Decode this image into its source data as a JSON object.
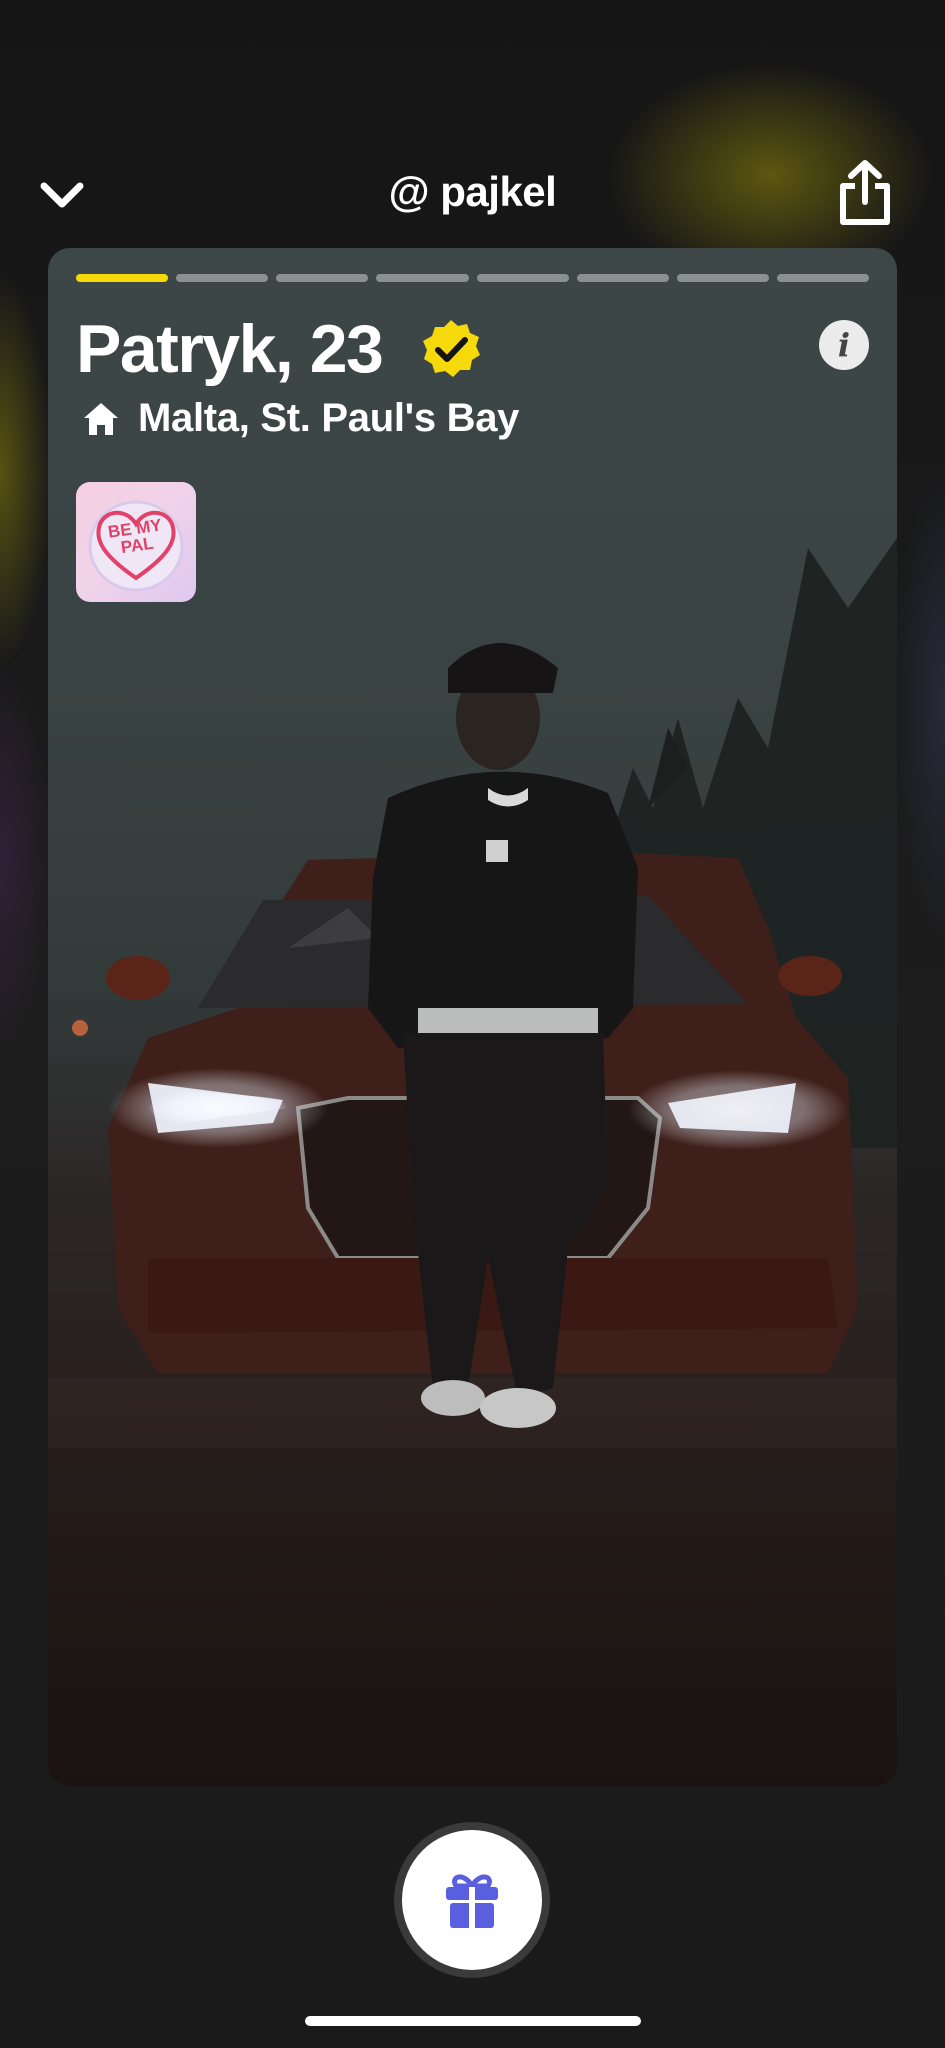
{
  "header": {
    "username": "@ pajkel",
    "back_icon": "chevron-down-icon",
    "share_icon": "share-icon"
  },
  "story": {
    "segments_total": 8,
    "segment_active": 1,
    "active_color": "#f5d90a"
  },
  "profile": {
    "name_age": "Patryk, 23",
    "verified_icon": "verified-badge-icon",
    "verified_color": "#f5d90a",
    "location_icon": "home-icon",
    "location": "Malta, St. Paul's Bay",
    "info_icon": "info-icon",
    "info_glyph": "i"
  },
  "badge": {
    "line1": "BE MY",
    "line2": "PAL"
  },
  "actions": {
    "gift_icon": "gift-icon",
    "gift_color": "#5a5fe0"
  }
}
